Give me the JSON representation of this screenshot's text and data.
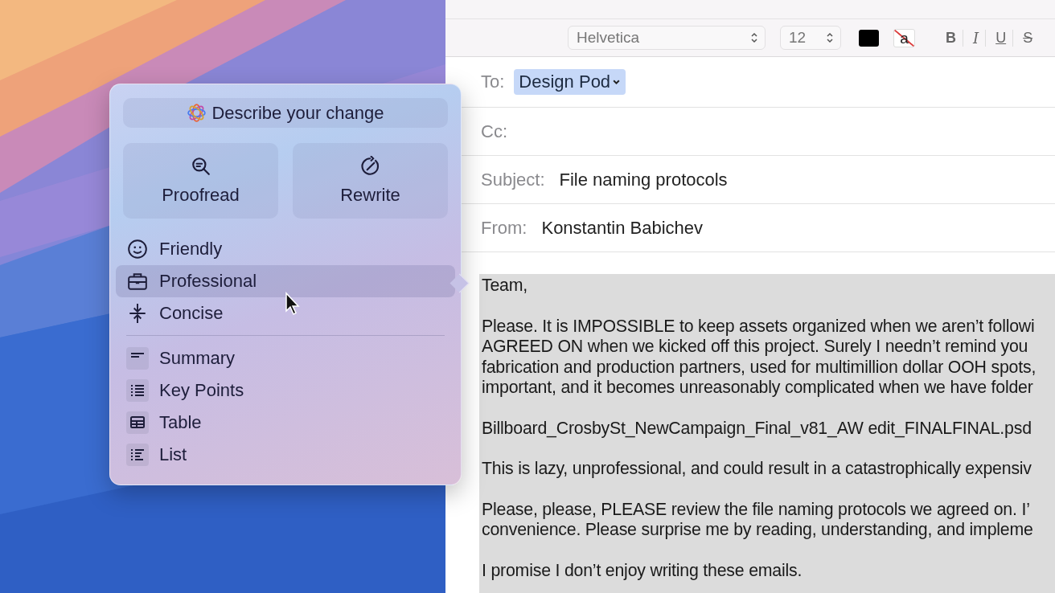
{
  "popover": {
    "prompt": "Describe your change",
    "actions": [
      {
        "label": "Proofread"
      },
      {
        "label": "Rewrite"
      }
    ],
    "tones": [
      {
        "label": "Friendly",
        "selected": false
      },
      {
        "label": "Professional",
        "selected": true
      },
      {
        "label": "Concise",
        "selected": false
      }
    ],
    "formats": [
      {
        "label": "Summary"
      },
      {
        "label": "Key Points"
      },
      {
        "label": "Table"
      },
      {
        "label": "List"
      }
    ]
  },
  "toolbar": {
    "font": "Helvetica",
    "size": "12",
    "highlight": "a",
    "styles": [
      {
        "label": "B",
        "kind": "bold"
      },
      {
        "label": "I",
        "kind": "italic"
      },
      {
        "label": "U",
        "kind": "underline"
      },
      {
        "label": "S",
        "kind": "strike"
      }
    ]
  },
  "fields": [
    {
      "label": "To:",
      "value": "Design Pod",
      "kind": "recipient"
    },
    {
      "label": "Cc:",
      "kind": "text"
    },
    {
      "label": "Subject:",
      "value": "File naming protocols",
      "kind": "text"
    },
    {
      "label": "From:",
      "value": "Konstantin Babichev",
      "kind": "text"
    }
  ],
  "body": [
    [
      "Team,"
    ],
    [
      "Please. It is IMPOSSIBLE to keep assets organized when we aren’t followi",
      "AGREED ON when we kicked off this project. Surely I needn’t remind you",
      "fabrication and production partners, used for multimillion dollar OOH spots,",
      "important, and it becomes unreasonably complicated when we have folder"
    ],
    [
      "Billboard_CrosbySt_NewCampaign_Final_v81_AW edit_FINALFINAL.psd"
    ],
    [
      "This is lazy, unprofessional, and could result in a catastrophically expensiv"
    ],
    [
      "Please, please, PLEASE review the file naming protocols we agreed on. I’",
      "convenience. Please surprise me by reading, understanding, and impleme"
    ],
    [
      "I promise I don’t enjoy writing these emails."
    ]
  ]
}
